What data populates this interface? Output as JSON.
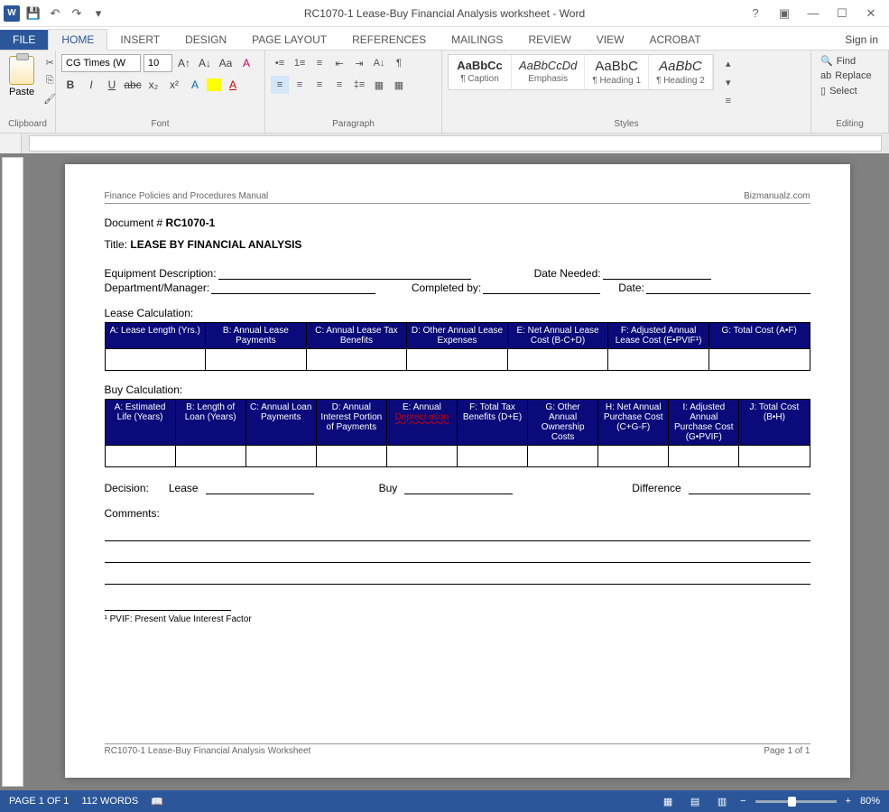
{
  "titlebar": {
    "title": "RC1070-1 Lease-Buy Financial Analysis worksheet - Word"
  },
  "tabs": {
    "file": "FILE",
    "home": "HOME",
    "insert": "INSERT",
    "design": "DESIGN",
    "pagelayout": "PAGE LAYOUT",
    "references": "REFERENCES",
    "mailings": "MAILINGS",
    "review": "REVIEW",
    "view": "VIEW",
    "acrobat": "ACROBAT",
    "signin": "Sign in"
  },
  "ribbon": {
    "clipboard": {
      "label": "Clipboard",
      "paste": "Paste"
    },
    "font": {
      "label": "Font",
      "name": "CG Times (W",
      "size": "10"
    },
    "paragraph": {
      "label": "Paragraph"
    },
    "styles": {
      "label": "Styles",
      "items": [
        {
          "preview": "AaBbCc",
          "name": "¶ Caption"
        },
        {
          "preview": "AaBbCcDd",
          "name": "Emphasis"
        },
        {
          "preview": "AaBbC",
          "name": "¶ Heading 1"
        },
        {
          "preview": "AaBbC",
          "name": "¶ Heading 2"
        }
      ]
    },
    "editing": {
      "label": "Editing",
      "find": "Find",
      "replace": "Replace",
      "select": "Select"
    }
  },
  "document": {
    "header_left": "Finance Policies and Procedures Manual",
    "header_right": "Bizmanualz.com",
    "doc_num_label": "Document # ",
    "doc_num": "RC1070-1",
    "title_label": "Title: ",
    "title": "LEASE BY FINANCIAL ANALYSIS",
    "fields": {
      "equip": "Equipment Description:",
      "date_needed": "Date Needed:",
      "dept": "Department/Manager:",
      "completed": "Completed by:",
      "date": "Date:"
    },
    "lease_calc_label": "Lease Calculation:",
    "lease_headers": [
      "A:  Lease Length (Yrs.)",
      "B:  Annual Lease Payments",
      "C:  Annual Lease Tax Benefits",
      "D: Other Annual Lease Expenses",
      "E:  Net Annual Lease Cost  (B-C+D)",
      "F:  Adjusted Annual Lease Cost (E•PVIF¹)",
      "G:  Total Cost (A•F)"
    ],
    "buy_calc_label": "Buy Calculation:",
    "buy_headers": [
      "A: Estimated Life (Years)",
      "B: Length of Loan (Years)",
      "C: Annual Loan Payments",
      "D: Annual Interest Portion of Payments",
      "E: Annual Depreci-ation",
      "F: Total Tax Benefits (D+E)",
      "G: Other Annual Ownership Costs",
      "H: Net Annual Purchase Cost (C+G-F)",
      "I:  Adjusted Annual Purchase Cost (G•PVIF)",
      "J: Total Cost (B•H)"
    ],
    "decision": {
      "label": "Decision:",
      "lease": "Lease",
      "buy": "Buy",
      "diff": "Difference"
    },
    "comments": "Comments:",
    "footnote": "¹ PVIF:  Present Value Interest Factor",
    "footer_left": "RC1070-1 Lease-Buy Financial Analysis Worksheet",
    "footer_right": "Page 1 of 1"
  },
  "statusbar": {
    "page": "PAGE 1 OF 1",
    "words": "112 WORDS",
    "zoom": "80%"
  }
}
